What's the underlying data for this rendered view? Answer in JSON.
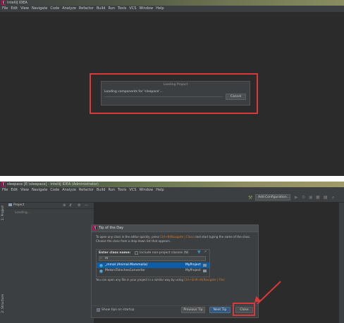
{
  "top": {
    "title": "IntelliJ IDEA",
    "menu": [
      "File",
      "Edit",
      "View",
      "Navigate",
      "Code",
      "Analyze",
      "Refactor",
      "Build",
      "Run",
      "Tools",
      "VCS",
      "Window",
      "Help"
    ],
    "loading_dialog": {
      "title": "Loading Project",
      "message": "Loading components for 'sleepace'...",
      "cancel": "Cancel"
    }
  },
  "bottom": {
    "title": "sleepace [E:\\sleepace] - IntelliJ IDEA (Administrator)",
    "menu": [
      "File",
      "Edit",
      "View",
      "Navigate",
      "Code",
      "Analyze",
      "Refactor",
      "Build",
      "Run",
      "Tools",
      "VCS",
      "Window",
      "Help"
    ],
    "add_configuration": "Add Configuration...",
    "left_tab": "1: Project",
    "bottom_left_tab": "2: Structure",
    "project_panel": {
      "header": "Project",
      "loading": "Loading..."
    },
    "tip_dialog": {
      "title": "Tip of the Day",
      "text1_a": "To open any class in the editor quickly, press ",
      "text1_key1": "Ctrl+N(Navigate | Class)",
      "text1_b": " and start typing the name of the class. Choose the class from a drop-down list that appears.",
      "enter_class_label": "Enter class name:",
      "include_nonproject": "Include non-project classes (N)",
      "search_value": "m",
      "results": [
        {
          "name": "_mmal (Animal.Mammalia)",
          "location": "MyProject"
        },
        {
          "name": "MetersToInchesConverter",
          "location": "MyProject"
        }
      ],
      "text2_a": "You can open any file in your project in a similar way by using ",
      "text2_key": "Ctrl+Shift+N(Navigate | File)",
      "show_tips": "Show tips on startup",
      "previous": "Previous Tip",
      "next": "Next Tip",
      "close": "Close"
    }
  },
  "colors": {
    "highlight_red": "#d9393a",
    "accent_blue": "#365880",
    "key_orange": "#cc7832"
  }
}
